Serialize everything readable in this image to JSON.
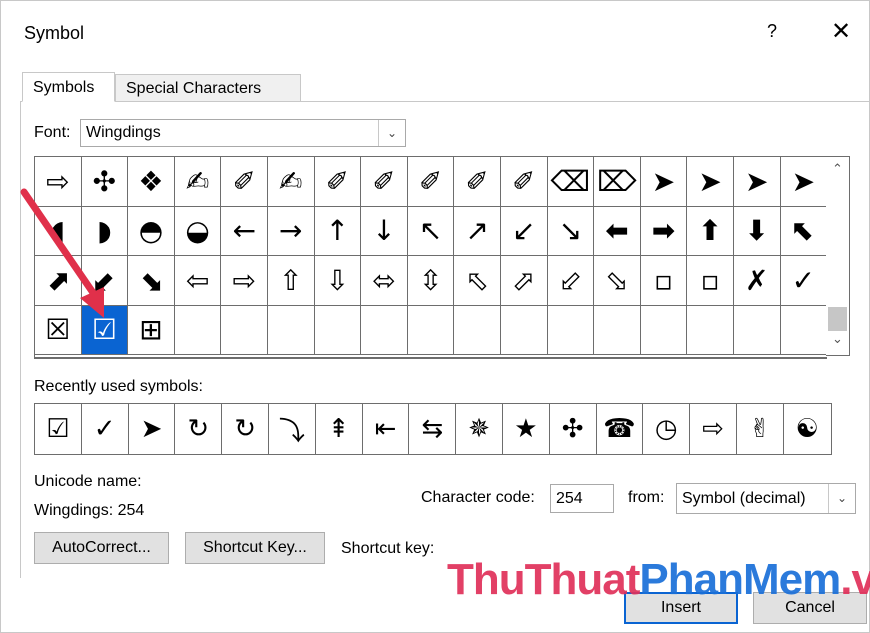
{
  "dialog": {
    "title": "Symbol",
    "help": "?",
    "close": "✕"
  },
  "tabs": {
    "symbols": "Symbols",
    "special": "Special Characters"
  },
  "font": {
    "label": "Font:",
    "value": "Wingdings"
  },
  "grid": {
    "rows": [
      [
        "⇨",
        "✣",
        "❖",
        "✍",
        "✐",
        "✍",
        "✐",
        "✐",
        "✐",
        "✐",
        "✐",
        "⌫",
        "⌦",
        "➤",
        "➤",
        "➤",
        "➤"
      ],
      [
        "◖",
        "◗",
        "◓",
        "◒",
        "←",
        "→",
        "↑",
        "↓",
        "↖",
        "↗",
        "↙",
        "↘",
        "⬅",
        "➡",
        "⬆",
        "⬇",
        "⬉"
      ],
      [
        "⬈",
        "⬋",
        "⬊",
        "⇦",
        "⇨",
        "⇧",
        "⇩",
        "⬄",
        "⇳",
        "⬁",
        "⬀",
        "⬃",
        "⬂",
        "▫",
        "▫",
        "✗",
        "✓"
      ],
      [
        "☒",
        "☑",
        "⊞",
        "",
        "",
        "",
        "",
        "",
        "",
        "",
        "",
        "",
        "",
        "",
        "",
        "",
        ""
      ]
    ],
    "selected_row": 3,
    "selected_col": 1
  },
  "recent": {
    "label": "Recently used symbols:",
    "items": [
      "☑",
      "✓",
      "➤",
      "↻",
      "↻",
      "⤵",
      "⇞",
      "⇤",
      "⇆",
      "✵",
      "★",
      "✣",
      "☎",
      "◷",
      "⇨",
      "✌",
      "☯"
    ]
  },
  "unicode_name": {
    "label": "Unicode name:",
    "value": "Wingdings: 254"
  },
  "character_code": {
    "label": "Character code:",
    "value": "254"
  },
  "from": {
    "label": "from:",
    "value": "Symbol (decimal)"
  },
  "buttons": {
    "autocorrect": "AutoCorrect...",
    "shortcut_key": "Shortcut Key...",
    "insert": "Insert",
    "cancel": "Cancel"
  },
  "shortcut_key_label": "Shortcut key:",
  "watermark": {
    "part1": "ThuThuat",
    "part2": "PhanMem",
    "part3": ".vn"
  },
  "colors": {
    "accent": "#0a64d2",
    "arrow": "#e0304a",
    "watermark_red": "#e0305a",
    "watermark_blue": "#1a6fd8"
  }
}
